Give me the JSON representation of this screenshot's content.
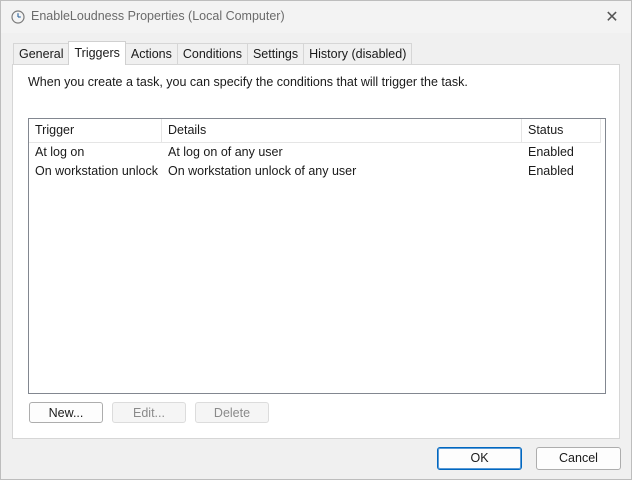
{
  "window": {
    "title": "EnableLoudness Properties (Local Computer)",
    "close_glyph": "✕"
  },
  "tabs": [
    {
      "label": "General",
      "active": false
    },
    {
      "label": "Triggers",
      "active": true
    },
    {
      "label": "Actions",
      "active": false
    },
    {
      "label": "Conditions",
      "active": false
    },
    {
      "label": "Settings",
      "active": false
    },
    {
      "label": "History (disabled)",
      "active": false
    }
  ],
  "triggers_panel": {
    "description": "When you create a task, you can specify the conditions that will trigger the task.",
    "columns": {
      "trigger": "Trigger",
      "details": "Details",
      "status": "Status"
    },
    "rows": [
      {
        "trigger": "At log on",
        "details": "At log on of any user",
        "status": "Enabled"
      },
      {
        "trigger": "On workstation unlock",
        "details": "On workstation unlock of any user",
        "status": "Enabled"
      }
    ],
    "buttons": {
      "new": "New...",
      "edit": "Edit...",
      "delete": "Delete"
    }
  },
  "footer": {
    "ok": "OK",
    "cancel": "Cancel"
  },
  "icons": {
    "app": "task-clock-icon",
    "close": "close-icon"
  }
}
